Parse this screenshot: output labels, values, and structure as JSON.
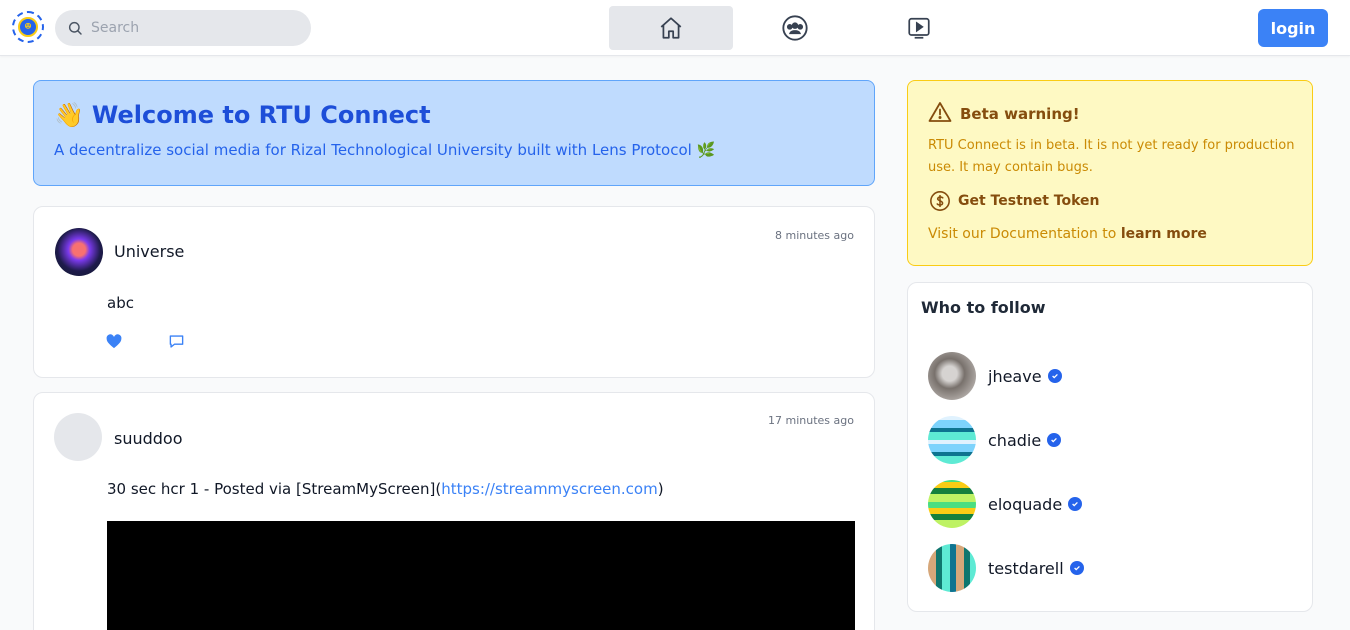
{
  "header": {
    "search_placeholder": "Search",
    "login_label": "login"
  },
  "welcome": {
    "emoji": "👋",
    "title": "Welcome to RTU Connect",
    "subtitle": "A decentralize social media for Rizal Technological University built with Lens Protocol 🌿"
  },
  "posts": [
    {
      "username": "Universe",
      "time": "8 minutes ago",
      "content": "abc"
    },
    {
      "username": "suuddoo",
      "time": "17 minutes ago",
      "content_prefix": "30 sec hcr 1 -  Posted via [StreamMyScreen](",
      "link": "https://streammyscreen.com",
      "content_suffix": ")"
    }
  ],
  "beta": {
    "title": "Beta warning!",
    "text": "RTU Connect is in beta. It is not yet ready for production use. It may contain bugs.",
    "token_label": "Get Testnet Token",
    "doc_prefix": "Visit our Documentation to ",
    "doc_link": "learn more"
  },
  "follow": {
    "title": "Who to follow",
    "users": [
      {
        "name": "jheave"
      },
      {
        "name": "chadie"
      },
      {
        "name": "eloquade"
      },
      {
        "name": "testdarell"
      }
    ]
  },
  "colors": {
    "accent": "#3b82f6",
    "welcome_bg": "#bfdbfe",
    "beta_bg": "#fef9c3",
    "verified": "#2563eb"
  }
}
